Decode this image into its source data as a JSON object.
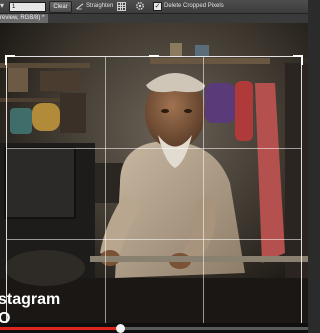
{
  "options_bar": {
    "value_field": "1",
    "clear_label": "Clear",
    "straighten_label": "Straighten",
    "delete_cropped_label": "Delete Cropped Pixels",
    "delete_cropped_checked": "✓"
  },
  "document": {
    "tab_label": "review, RGB/8) *"
  },
  "watermark": {
    "line1": "stagram",
    "line2": "O"
  },
  "video": {
    "progress_fraction": 0.39
  }
}
